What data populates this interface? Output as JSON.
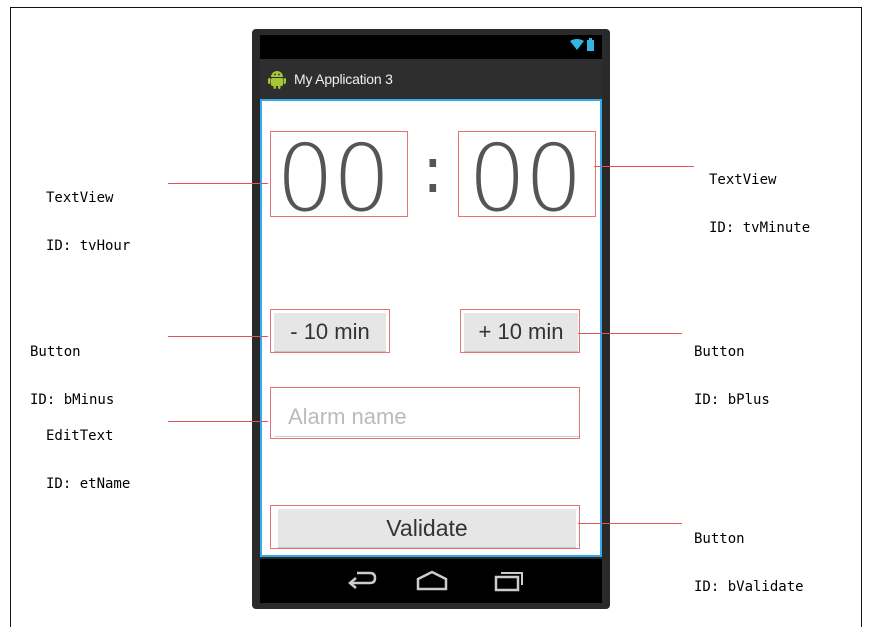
{
  "app": {
    "title": "My Application 3"
  },
  "timer": {
    "hour": "00",
    "separator": ":",
    "minute": "00"
  },
  "buttons": {
    "minus_label": "- 10 min",
    "plus_label": "+ 10 min",
    "validate_label": "Validate"
  },
  "edit_text": {
    "placeholder": "Alarm name"
  },
  "annotations": {
    "tv_hour": {
      "type": "TextView",
      "id": "ID: tvHour"
    },
    "tv_minute": {
      "type": "TextView",
      "id": "ID: tvMinute"
    },
    "b_minus": {
      "type": "Button",
      "id": "ID: bMinus"
    },
    "b_plus": {
      "type": "Button",
      "id": "ID: bPlus"
    },
    "et_name": {
      "type": "EditText",
      "id": "ID: etName"
    },
    "b_validate": {
      "type": "Button",
      "id": "ID: bValidate"
    }
  },
  "colors": {
    "annotation_line": "#e05555",
    "screen_border": "#33aaee",
    "status_icon": "#33b5e5",
    "android_green": "#a4c639"
  },
  "icons": [
    "wifi-icon",
    "battery-icon",
    "android-icon",
    "back-icon",
    "home-icon",
    "recents-icon"
  ]
}
